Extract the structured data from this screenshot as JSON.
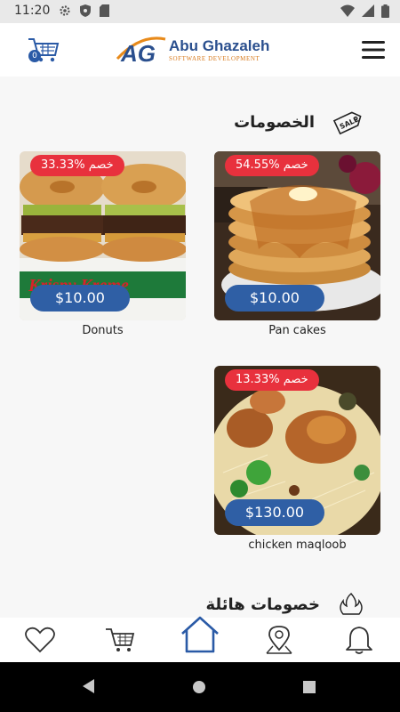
{
  "status_bar": {
    "time": "11:20",
    "left_icons": [
      "settings-icon",
      "shield-icon",
      "sd-card-icon"
    ],
    "right_icons": [
      "wifi-icon",
      "signal-icon",
      "battery-icon"
    ]
  },
  "app_bar": {
    "cart_count": "0",
    "logo_initials": "AG",
    "logo_name": "Abu Ghazaleh",
    "logo_tagline": "SOFTWARE DEVELOPMENT",
    "menu_icon": "hamburger-menu-icon"
  },
  "sections": [
    {
      "title": "الخصومات",
      "icon": "sale-tag-icon",
      "items": [
        {
          "name": "Pan cakes",
          "price": "$10.00",
          "discount": "54.55% خصم",
          "image": "pancakes-photo"
        },
        {
          "name": "Donuts",
          "price": "$10.00",
          "discount": "33.33% خصم",
          "image": "donuts-photo"
        },
        {
          "name": "chicken maqloob",
          "price": "$130.00",
          "discount": "13.33% خصم",
          "image": "chicken-maqloob-photo"
        }
      ]
    },
    {
      "title": "خصومات هائلة",
      "icon": "fire-icon"
    }
  ],
  "bottom_nav": [
    "favorites-heart-icon",
    "shopping-cart-icon",
    "home-icon",
    "location-pin-icon",
    "notifications-bell-icon"
  ],
  "colors": {
    "accent": "#2f5fa5",
    "discount": "#e8313d",
    "active_nav": "#2a5aa6"
  }
}
